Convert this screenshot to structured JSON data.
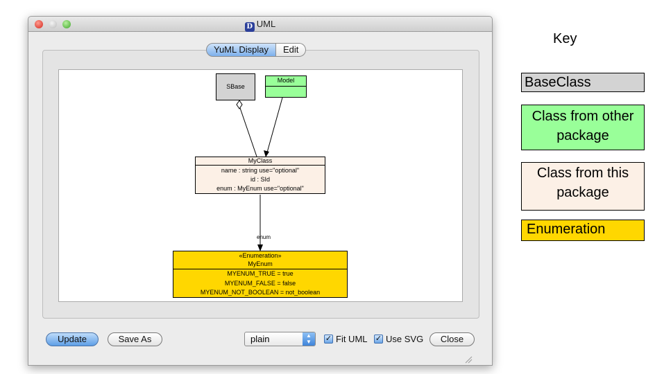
{
  "window": {
    "title": "UML",
    "app_icon": "D"
  },
  "tabs": [
    {
      "label": "YuML Display"
    },
    {
      "label": "Edit"
    }
  ],
  "diagram": {
    "sbase": {
      "label": "SBase",
      "color": "#d3d3d3"
    },
    "model": {
      "label": "Model",
      "color": "#99ff99"
    },
    "myclass": {
      "name": "MyClass",
      "color": "#fcf0e6",
      "attributes": [
        "name : string use=\"optional\"",
        "id : SId",
        "enum : MyEnum use=\"optional\""
      ]
    },
    "edge_label": "enum",
    "myenum": {
      "stereotype": "«Enumeration»",
      "name": "MyEnum",
      "color": "#ffd700",
      "values": [
        "MYENUM_TRUE = true",
        "MYENUM_FALSE = false",
        "MYENUM_NOT_BOOLEAN = not_boolean"
      ]
    }
  },
  "controls": {
    "update_label": "Update",
    "save_as_label": "Save As",
    "format_select": "plain",
    "fit_uml_label": "Fit UML",
    "fit_uml_checked": true,
    "use_svg_label": "Use SVG",
    "use_svg_checked": true,
    "close_label": "Close"
  },
  "key": {
    "title": "Key",
    "items": [
      {
        "label": "BaseClass",
        "color": "#d3d3d3"
      },
      {
        "label": "Class from other package",
        "color": "#99ff99"
      },
      {
        "label": "Class from this package",
        "color": "#fcf0e6"
      },
      {
        "label": "Enumeration",
        "color": "#ffd700"
      }
    ]
  }
}
